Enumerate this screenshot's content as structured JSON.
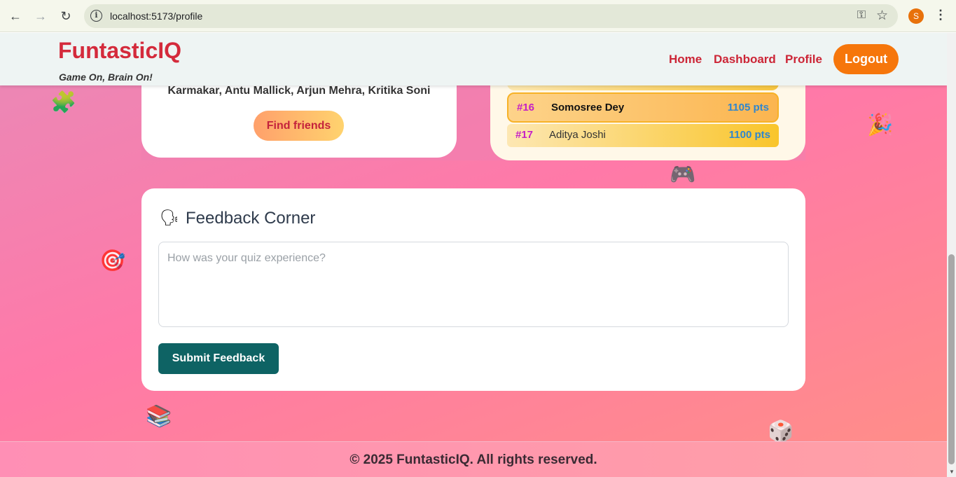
{
  "browser": {
    "url": "localhost:5173/profile",
    "profile_initial": "S"
  },
  "header": {
    "brand": "FuntasticIQ",
    "tagline": "Game On, Brain On!",
    "nav": {
      "home": "Home",
      "dashboard": "Dashboard",
      "profile": "Profile",
      "logout": "Logout"
    },
    "brand_color": "#d42a3b",
    "logout_color": "#f6760b"
  },
  "friends": {
    "names_line": "Karmakar, Antu Mallick, Arjun Mehra, Kritika Soni",
    "find_button": "Find friends"
  },
  "leaderboard": {
    "rows": [
      {
        "rank": "#16",
        "name": "Somosree Dey",
        "points": "1105 pts",
        "current_user": true
      },
      {
        "rank": "#17",
        "name": "Aditya Joshi",
        "points": "1100 pts",
        "current_user": false
      }
    ]
  },
  "feedback": {
    "icon": "speaking-head-icon",
    "title": "Feedback Corner",
    "placeholder": "How was your quiz experience?",
    "value": "",
    "submit": "Submit Feedback",
    "submit_color": "#0e6364"
  },
  "footer": {
    "text": "© 2025 FuntasticIQ. All rights reserved."
  },
  "decorations": [
    "puzzle-icon",
    "target-icon",
    "game-controller-icon",
    "party-icon",
    "dice-icon",
    "book-icon"
  ]
}
